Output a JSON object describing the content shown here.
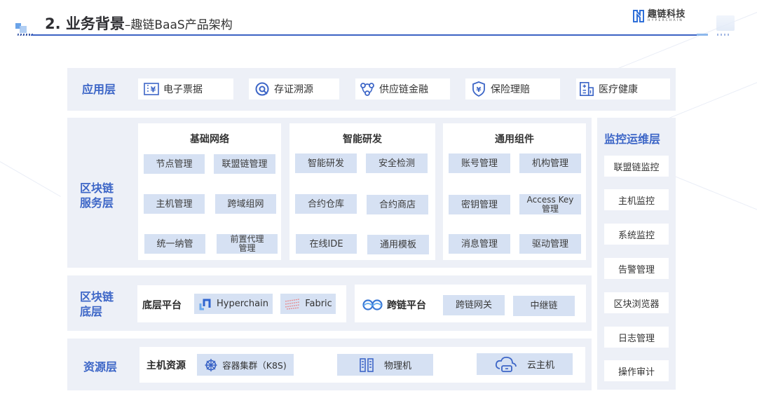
{
  "header": {
    "title_main": "2. 业务背景",
    "title_sub": "–趣链BaaS产品架构"
  },
  "logo": {
    "name_cn": "趣链科技",
    "name_en": "HYPERCHAIN"
  },
  "colors": {
    "accent": "#3d66c7",
    "panel_bg": "#edf0f7",
    "chip_bg": "#d6e1f3",
    "header_line": "#3c62c4"
  },
  "app_layer": {
    "label": "应用层",
    "items": [
      {
        "icon": "receipt-yen-icon",
        "label": "电子票据"
      },
      {
        "icon": "trace-search-icon",
        "label": "存证溯源"
      },
      {
        "icon": "supply-chain-icon",
        "label": "供应链金融"
      },
      {
        "icon": "shield-yen-icon",
        "label": "保险理赔"
      },
      {
        "icon": "hospital-icon",
        "label": "医疗健康"
      }
    ]
  },
  "service_layer": {
    "label_line1": "区块链",
    "label_line2": "服务层",
    "groups": [
      {
        "title": "基础网络",
        "items": [
          "节点管理",
          "联盟链管理",
          "主机管理",
          "跨域组网",
          "统一纳管",
          "前置代理\n管理"
        ]
      },
      {
        "title": "智能研发",
        "items": [
          "智能研发",
          "安全检测",
          "合约仓库",
          "合约商店",
          "在线IDE",
          "通用模板"
        ]
      },
      {
        "title": "通用组件",
        "items": [
          "账号管理",
          "机构管理",
          "密钥管理",
          "Access Key\n管理",
          "消息管理",
          "驱动管理"
        ]
      }
    ]
  },
  "monitor_layer": {
    "label": "监控运维层",
    "items": [
      "联盟链监控",
      "主机监控",
      "系统监控",
      "告警管理",
      "区块浏览器",
      "日志管理",
      "操作审计"
    ]
  },
  "base_layer": {
    "label_line1": "区块链",
    "label_line2": "底层",
    "platform_label": "底层平台",
    "platforms": [
      {
        "icon": "hyperchain-icon",
        "label": "Hyperchain"
      },
      {
        "icon": "fabric-icon",
        "label": "Fabric"
      }
    ],
    "crosschain_label": "跨链平台",
    "crosschain_items": [
      "跨链网关",
      "中继链"
    ]
  },
  "resource_layer": {
    "label": "资源层",
    "host_label": "主机资源",
    "items": [
      {
        "icon": "kubernetes-icon",
        "label": "容器集群（K8S)"
      },
      {
        "icon": "server-icon",
        "label": "物理机"
      },
      {
        "icon": "cloud-host-icon",
        "label": "云主机"
      }
    ]
  }
}
